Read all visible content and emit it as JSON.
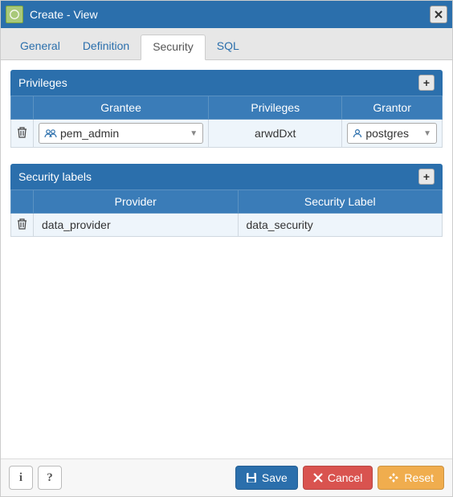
{
  "window": {
    "title": "Create - View"
  },
  "tabs": {
    "general": "General",
    "definition": "Definition",
    "security": "Security",
    "sql": "SQL",
    "active": "security"
  },
  "privileges": {
    "title": "Privileges",
    "columns": {
      "grantee": "Grantee",
      "privileges": "Privileges",
      "grantor": "Grantor"
    },
    "rows": [
      {
        "grantee": "pem_admin",
        "privileges": "arwdDxt",
        "grantor": "postgres"
      }
    ]
  },
  "security_labels": {
    "title": "Security labels",
    "columns": {
      "provider": "Provider",
      "security_label": "Security Label"
    },
    "rows": [
      {
        "provider": "data_provider",
        "security_label": "data_security"
      }
    ]
  },
  "footer": {
    "save": "Save",
    "cancel": "Cancel",
    "reset": "Reset"
  }
}
